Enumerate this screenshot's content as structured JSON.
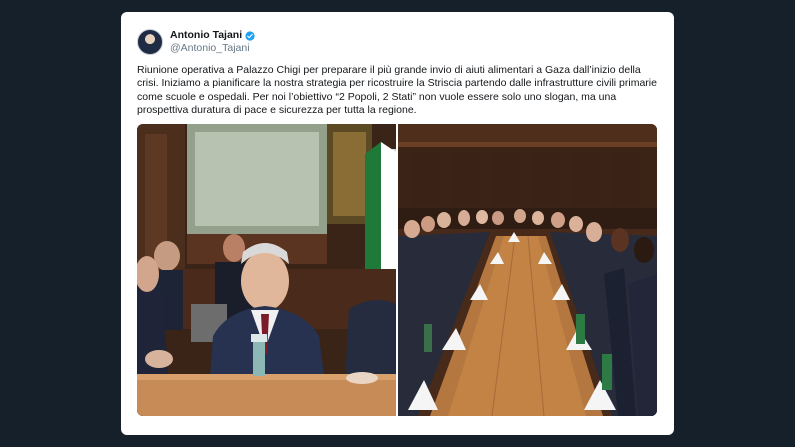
{
  "tweet": {
    "display_name": "Antonio Tajani",
    "handle": "@Antonio_Tajani",
    "text": "Riunione operativa a Palazzo Chigi per preparare il più grande invio di aiuti alimentari a Gaza dall’inizio della crisi. Iniziamo a pianificare la nostra strategia per ricostruire la Striscia partendo dalle infrastrutture civili primarie come scuole e ospedali. Per noi l’obiettivo “2 Popoli, 2 Stati” non vuole essere solo uno slogan, ma una prospettiva duratura di pace e sicurezza per tutta la regione."
  },
  "colors": {
    "background": "#15202b",
    "card": "#ffffff",
    "verified": "#1da1f2",
    "text": "#14171a",
    "secondary_text": "#657786"
  },
  "icons": {
    "verified": "verified-badge-icon"
  }
}
